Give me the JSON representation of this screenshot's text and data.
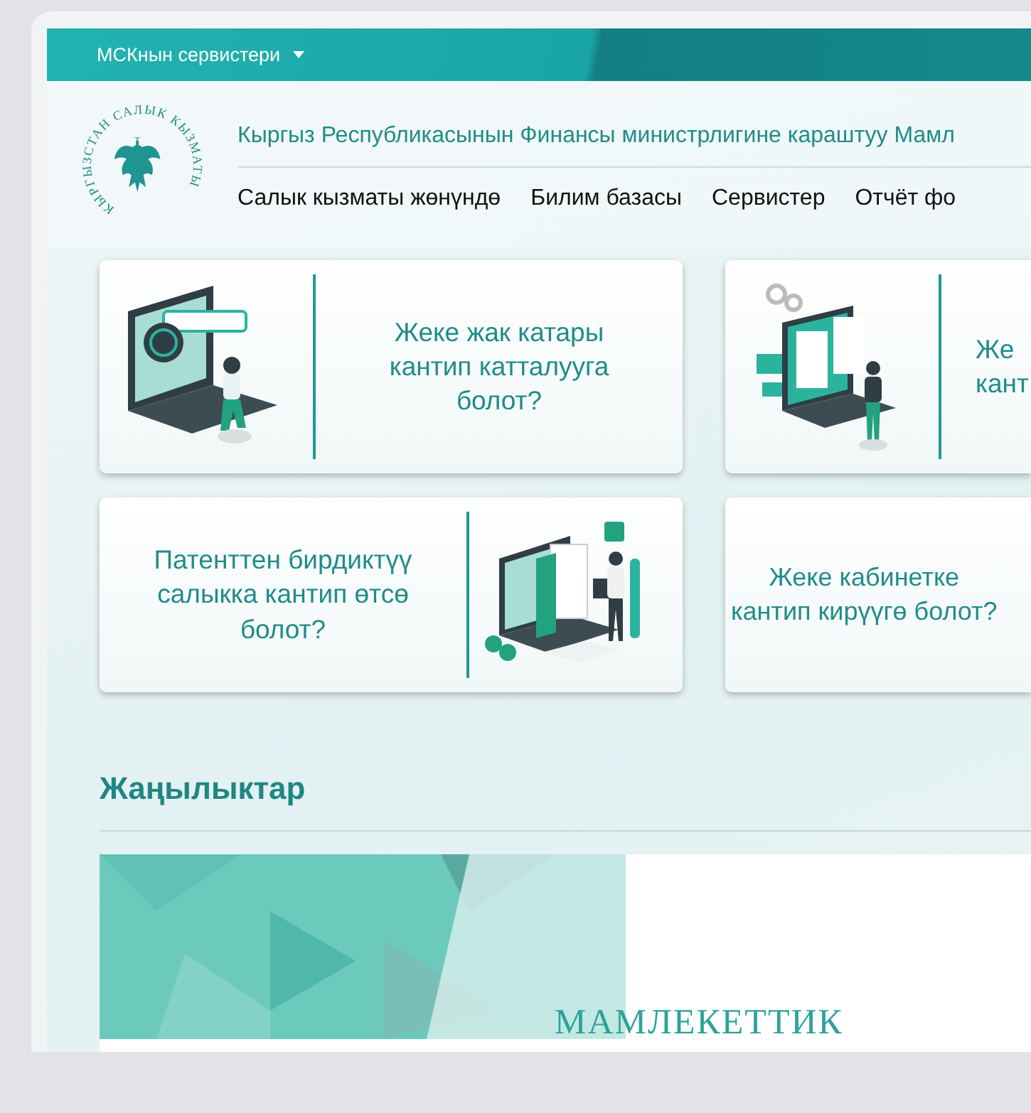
{
  "top_bar": {
    "services_menu": "МСКнын сервистери"
  },
  "header": {
    "logo_text": "КЫРГЫЗСТАН САЛЫК КЫЗМАТЫ",
    "title": "Кыргыз Республикасынын Финансы министрлигине караштуу Мамл",
    "nav": [
      {
        "label": "Салык кызматы жөнүндө"
      },
      {
        "label": "Билим базасы"
      },
      {
        "label": "Сервистер"
      },
      {
        "label": "Отчёт фо"
      }
    ]
  },
  "cards": [
    {
      "lines": [
        "Жеке жак катары",
        "кантип катталууга",
        "болот?"
      ],
      "illustration": {
        "kind": "laptop-globe",
        "first": true
      }
    },
    {
      "lines": [
        "Же",
        "кант"
      ],
      "illustration": {
        "kind": "laptop-forms",
        "first": true
      }
    },
    {
      "lines": [
        "Патенттен бирдиктүү",
        "салыкка кантип өтсө",
        "болот?"
      ],
      "illustration": {
        "kind": "invoice",
        "first": false
      }
    },
    {
      "lines": [
        "Жеке кабинетке",
        "кантип кирүүгө болот?"
      ]
    }
  ],
  "news": {
    "heading": "Жаңылыктар",
    "banner_title": "МАМЛЕКЕТТИК"
  }
}
